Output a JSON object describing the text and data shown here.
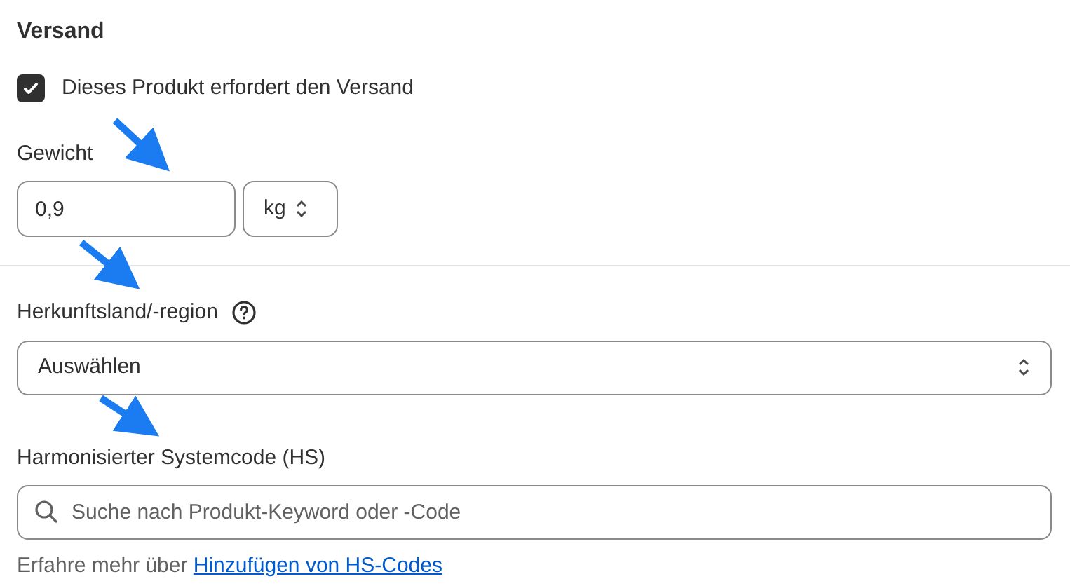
{
  "section_title": "Versand",
  "shipping_required": {
    "label": "Dieses Produkt erfordert den Versand",
    "checked": true
  },
  "weight": {
    "label": "Gewicht",
    "value": "0,9",
    "unit": "kg"
  },
  "origin": {
    "label": "Herkunftsland/-region",
    "value": "Auswählen"
  },
  "hs_code": {
    "label": "Harmonisierter Systemcode (HS)",
    "placeholder": "Suche nach Produkt-Keyword oder -Code"
  },
  "help": {
    "text": "Erfahre mehr über",
    "link": "Hinzufügen von HS-Codes"
  }
}
